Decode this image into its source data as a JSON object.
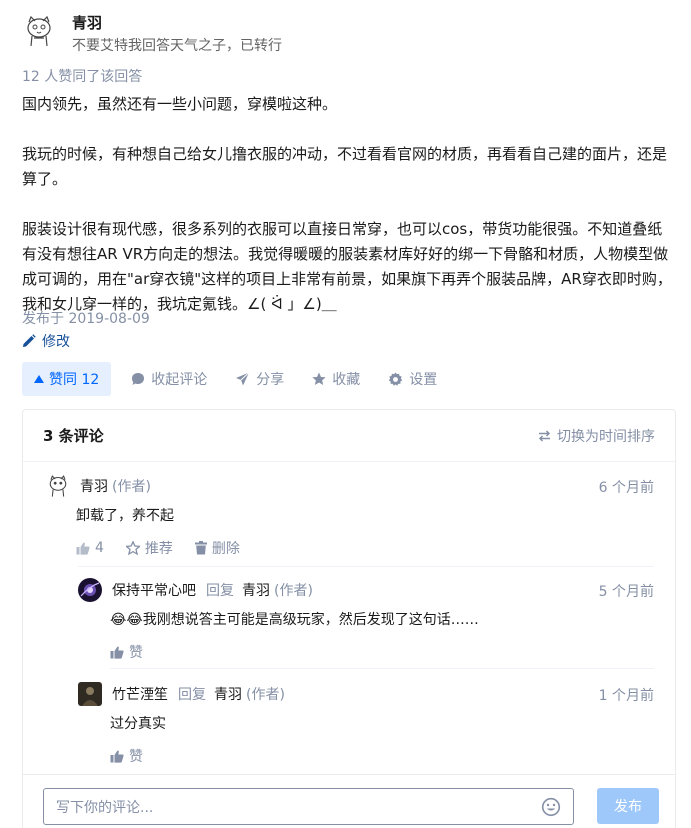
{
  "author": {
    "name": "青羽",
    "bio": "不要艾特我回答天气之子，已转行"
  },
  "answer": {
    "voters_text": "12 人赞同了该回答",
    "paragraphs": [
      "国内领先，虽然还有一些小问题，穿模啦这种。",
      "我玩的时候，有种想自己给女儿撸衣服的冲动，不过看看官网的材质，再看看自己建的面片，还是算了。",
      "服装设计很有现代感，很多系列的衣服可以直接日常穿，也可以cos，带货功能很强。不知道叠纸有没有想往AR VR方向走的想法。我觉得暖暖的服装素材库好好的绑一下骨骼和材质，人物模型做成可调的，用在\"ar穿衣镜\"这样的项目上非常有前景，如果旗下再弄个服装品牌，AR穿衣即时购，我和女儿穿一样的，我坑定氪钱。∠( ᐛ 」∠)＿"
    ],
    "published": "发布于 2019-08-09",
    "edit_label": "修改"
  },
  "actions": {
    "vote_label": "赞同 12",
    "collapse_comments": "收起评论",
    "share": "分享",
    "favorite": "收藏",
    "settings": "设置"
  },
  "comments": {
    "count_label": "3 条评论",
    "sort_label": "切换为时间排序",
    "items": [
      {
        "author": "青羽",
        "tag": "(作者)",
        "time": "6 个月前",
        "body": "卸载了，养不起",
        "likes": "4",
        "recommend": "推荐",
        "delete": "删除"
      },
      {
        "author": "保持平常心吧",
        "reply_word": "回复",
        "reply_to": "青羽",
        "tag": "(作者)",
        "time": "5 个月前",
        "body": "😂😂我刚想说答主可能是高级玩家，然后发现了这句话……",
        "like": "赞"
      },
      {
        "author": "竹芒湮笙",
        "reply_word": "回复",
        "reply_to": "青羽",
        "tag": "(作者)",
        "time": "1 个月前",
        "body": "过分真实",
        "like": "赞"
      }
    ]
  },
  "composer": {
    "placeholder": "写下你的评论...",
    "submit": "发布"
  }
}
